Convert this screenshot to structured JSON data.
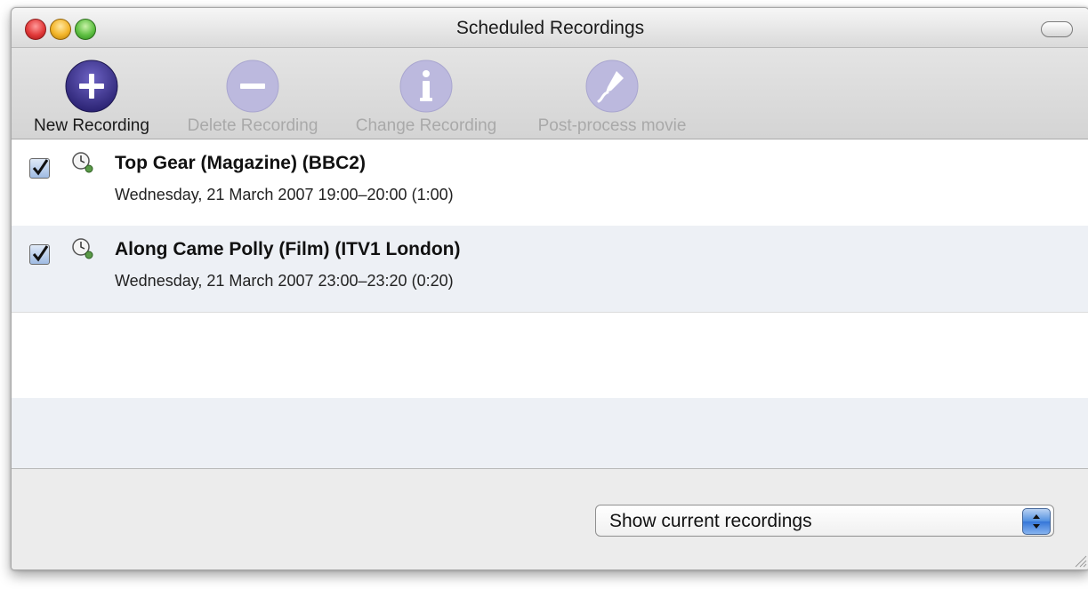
{
  "window": {
    "title": "Scheduled Recordings"
  },
  "toolbar": {
    "items": [
      {
        "label": "New Recording",
        "icon": "plus-icon",
        "enabled": true
      },
      {
        "label": "Delete Recording",
        "icon": "minus-icon",
        "enabled": false
      },
      {
        "label": "Change Recording",
        "icon": "info-icon",
        "enabled": false
      },
      {
        "label": "Post-process movie",
        "icon": "script-icon",
        "enabled": false
      }
    ]
  },
  "recordings": [
    {
      "checked": true,
      "title": "Top Gear (Magazine) (BBC2)",
      "when": "Wednesday, 21 March 2007  19:00–20:00 (1:00)"
    },
    {
      "checked": true,
      "title": "Along Came Polly (Film) (ITV1 London)",
      "when": "Wednesday, 21 March 2007  23:00–23:20 (0:20)"
    }
  ],
  "filter": {
    "selected": "Show current recordings"
  },
  "colors": {
    "accent": "#3576d8",
    "disabled_icon": "#b9b6dc",
    "enabled_icon": "#3a3180"
  }
}
